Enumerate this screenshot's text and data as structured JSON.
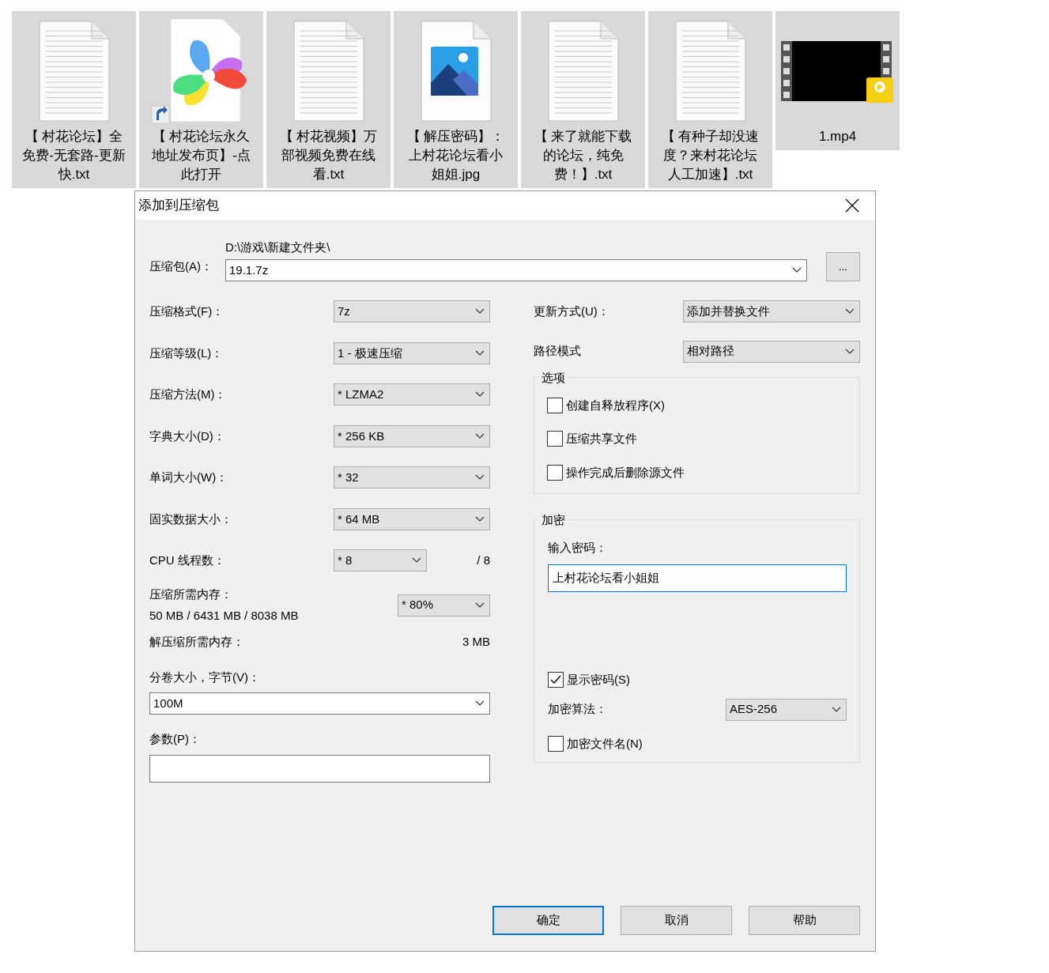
{
  "files": [
    {
      "name": "【 村花论坛】全免费-无套路-更新快.txt",
      "kind": "text"
    },
    {
      "name": "【 村花论坛永久地址发布页】-点此打开",
      "kind": "shortcut"
    },
    {
      "name": "【 村花视频】万部视频免费在线看.txt",
      "kind": "text"
    },
    {
      "name": "【 解压密码】：上村花论坛看小姐姐.jpg",
      "kind": "image"
    },
    {
      "name": "【 来了就能下载的论坛，纯免费！】.txt",
      "kind": "text"
    },
    {
      "name": "【 有种子却没速度？来村花论坛人工加速】.txt",
      "kind": "text"
    },
    {
      "name": "1.mp4",
      "kind": "video"
    }
  ],
  "dialog": {
    "title": "添加到压缩包",
    "archive": {
      "label": "压缩包(A)：",
      "path": "D:\\游戏\\新建文件夹\\",
      "value": "19.1.7z",
      "browse": "..."
    },
    "left_fields": [
      {
        "label": "压缩格式(F)：",
        "value": "7z"
      },
      {
        "label": "压缩等级(L)：",
        "value": "1 - 极速压缩"
      },
      {
        "label": "压缩方法(M)：",
        "value": "*  LZMA2"
      },
      {
        "label": "字典大小(D)：",
        "value": "*  256 KB"
      },
      {
        "label": "单词大小(W)：",
        "value": "*  32"
      },
      {
        "label": "固实数据大小：",
        "value": "*  64 MB"
      }
    ],
    "cpu": {
      "label": "CPU 线程数：",
      "value": "*  8",
      "max": "/ 8"
    },
    "memory": {
      "label": "压缩所需内存：",
      "detail": "50 MB / 6431 MB / 8038 MB",
      "value": "* 80%"
    },
    "decompress_memory": {
      "label": "解压缩所需内存：",
      "value": "3 MB"
    },
    "volume": {
      "label": "分卷大小，字节(V)：",
      "value": "100M"
    },
    "params": {
      "label": "参数(P)："
    },
    "update": {
      "label": "更新方式(U)：",
      "value": "添加并替换文件"
    },
    "path_mode": {
      "label": "路径模式",
      "value": "相对路径"
    },
    "options": {
      "title": "选项",
      "items": [
        {
          "label": "创建自释放程序(X)",
          "checked": false
        },
        {
          "label": "压缩共享文件",
          "checked": false
        },
        {
          "label": "操作完成后删除源文件",
          "checked": false
        }
      ]
    },
    "encryption": {
      "title": "加密",
      "password_label": "输入密码：",
      "password": "上村花论坛看小姐姐",
      "show_password": {
        "label": "显示密码(S)",
        "checked": true
      },
      "method_label": "加密算法：",
      "method": "AES-256",
      "encrypt_names": {
        "label": "加密文件名(N)",
        "checked": false
      }
    },
    "buttons": [
      {
        "label": "确定",
        "default": true
      },
      {
        "label": "取消",
        "default": false
      },
      {
        "label": "帮助",
        "default": false
      }
    ]
  }
}
